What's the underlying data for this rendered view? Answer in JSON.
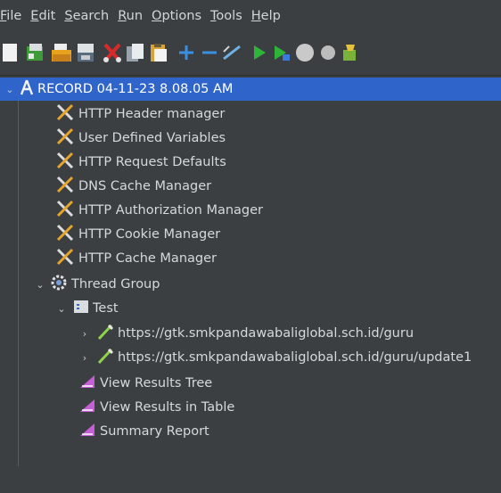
{
  "menu": [
    {
      "label": "File",
      "mnemonic": "F",
      "rest": "ile"
    },
    {
      "label": "Edit",
      "mnemonic": "E",
      "rest": "dit"
    },
    {
      "label": "Search",
      "mnemonic": "S",
      "rest": "earch"
    },
    {
      "label": "Run",
      "mnemonic": "R",
      "rest": "un"
    },
    {
      "label": "Options",
      "mnemonic": "O",
      "rest": "ptions"
    },
    {
      "label": "Tools",
      "mnemonic": "T",
      "rest": "ools"
    },
    {
      "label": "Help",
      "mnemonic": "H",
      "rest": "elp"
    }
  ],
  "toolbar": {
    "icons": [
      "new-icon",
      "templates-icon",
      "open-icon",
      "save-icon",
      "cut-icon",
      "copy-icon",
      "paste-icon",
      "expand-icon",
      "collapse-icon",
      "toggle-icon",
      "start-icon",
      "start-no-pauses-icon",
      "stop-icon",
      "shutdown-icon",
      "clear-icon"
    ]
  },
  "tree": {
    "root": {
      "label": "RECORD 04-11-23 8.08.05 AM"
    },
    "config_elements": [
      {
        "label": "HTTP Header manager"
      },
      {
        "label": "User Defined Variables"
      },
      {
        "label": "HTTP Request Defaults"
      },
      {
        "label": "DNS Cache Manager"
      },
      {
        "label": "HTTP Authorization Manager"
      },
      {
        "label": "HTTP Cookie Manager"
      },
      {
        "label": "HTTP Cache Manager"
      }
    ],
    "thread_group": {
      "label": "Thread Group"
    },
    "controller": {
      "label": "Test"
    },
    "samplers": [
      {
        "label": "https://gtk.smkpandawabaliglobal.sch.id/guru"
      },
      {
        "label": "https://gtk.smkpandawabaliglobal.sch.id/guru/update1"
      }
    ],
    "listeners": [
      {
        "label": "View Results Tree"
      },
      {
        "label": "View Results in Table"
      },
      {
        "label": "Summary Report"
      }
    ]
  },
  "colors": {
    "background": "#3c3f41",
    "selection": "#2f65ca"
  }
}
